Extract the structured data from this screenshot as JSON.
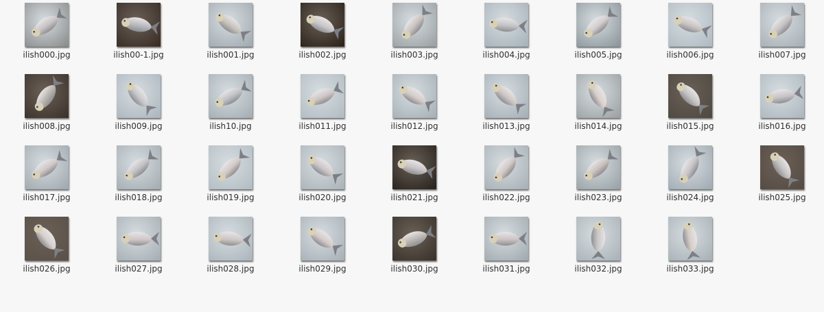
{
  "view": {
    "type": "icon-grid",
    "background": "#f7f7f7"
  },
  "files": [
    {
      "name": "ilish000.jpg",
      "bg": "#8e8f8f",
      "fish": "#c7c3c5",
      "angle": -35,
      "dark": false
    },
    {
      "name": "ilish00-1.jpg",
      "bg": "#3a2e26",
      "fish": "#b8b9be",
      "angle": 10,
      "dark": true
    },
    {
      "name": "ilish001.jpg",
      "bg": "#a3acb2",
      "fish": "#c6c2bb",
      "angle": 35,
      "dark": false
    },
    {
      "name": "ilish002.jpg",
      "bg": "#2d241c",
      "fish": "#c8c6c8",
      "angle": 25,
      "dark": true
    },
    {
      "name": "ilish003.jpg",
      "bg": "#9da3a5",
      "fish": "#c9c2c0",
      "angle": -50,
      "dark": false
    },
    {
      "name": "ilish004.jpg",
      "bg": "#a8b3bb",
      "fish": "#c3c4c6",
      "angle": 5,
      "dark": false
    },
    {
      "name": "ilish005.jpg",
      "bg": "#8f9a9e",
      "fish": "#d2cccd",
      "angle": -40,
      "dark": false
    },
    {
      "name": "ilish006.jpg",
      "bg": "#b1bcc3",
      "fish": "#c7c3c1",
      "angle": 20,
      "dark": false
    },
    {
      "name": "ilish007.jpg",
      "bg": "#a9b1b6",
      "fish": "#c6c3c4",
      "angle": -45,
      "dark": false
    },
    {
      "name": "ilish008.jpg",
      "bg": "#3d342c",
      "fish": "#b8b5b0",
      "angle": -55,
      "dark": true
    },
    {
      "name": "ilish009.jpg",
      "bg": "#aeb8bf",
      "fish": "#c5c6c9",
      "angle": 50,
      "dark": false
    },
    {
      "name": "ilish10.jpg",
      "bg": "#a6b0b6",
      "fish": "#bfc2c5",
      "angle": -30,
      "dark": false
    },
    {
      "name": "ilish011.jpg",
      "bg": "#b3bdc3",
      "fish": "#cdc8c6",
      "angle": -25,
      "dark": false
    },
    {
      "name": "ilish012.jpg",
      "bg": "#a8b2b7",
      "fish": "#d3cbc8",
      "angle": 30,
      "dark": false
    },
    {
      "name": "ilish013.jpg",
      "bg": "#a7b1b7",
      "fish": "#cbc4c2",
      "angle": 40,
      "dark": false
    },
    {
      "name": "ilish014.jpg",
      "bg": "#9ea4a5",
      "fish": "#d9d0cc",
      "angle": 60,
      "dark": false
    },
    {
      "name": "ilish015.jpg",
      "bg": "#4f4a42",
      "fish": "#c3c3c3",
      "angle": 45,
      "dark": true
    },
    {
      "name": "ilish016.jpg",
      "bg": "#aeb9bf",
      "fish": "#c5c4c7",
      "angle": -10,
      "dark": false
    },
    {
      "name": "ilish017.jpg",
      "bg": "#a2abb1",
      "fish": "#cfc8c7",
      "angle": -35,
      "dark": false
    },
    {
      "name": "ilish018.jpg",
      "bg": "#a6afb4",
      "fish": "#c1c2c4",
      "angle": -40,
      "dark": false
    },
    {
      "name": "ilish019.jpg",
      "bg": "#b4bec4",
      "fish": "#d2cac6",
      "angle": -45,
      "dark": false
    },
    {
      "name": "ilish020.jpg",
      "bg": "#acb5ba",
      "fish": "#cbc7c8",
      "angle": 35,
      "dark": false
    },
    {
      "name": "ilish021.jpg",
      "bg": "#2a2520",
      "fish": "#c7c3c4",
      "angle": 15,
      "dark": true
    },
    {
      "name": "ilish022.jpg",
      "bg": "#a9b2b7",
      "fish": "#d1c9c6",
      "angle": -50,
      "dark": false
    },
    {
      "name": "ilish023.jpg",
      "bg": "#9ba4a8",
      "fish": "#c9c1bd",
      "angle": -40,
      "dark": false
    },
    {
      "name": "ilish024.jpg",
      "bg": "#a3adb4",
      "fish": "#c6c5c7",
      "angle": -60,
      "dark": false
    },
    {
      "name": "ilish025.jpg",
      "bg": "#564c44",
      "fish": "#c4c1c1",
      "angle": 55,
      "dark": true
    },
    {
      "name": "ilish026.jpg",
      "bg": "#5a5148",
      "fish": "#d6cfcc",
      "angle": 50,
      "dark": true
    },
    {
      "name": "ilish027.jpg",
      "bg": "#a7b0b5",
      "fish": "#d0c8c8",
      "angle": 0,
      "dark": false
    },
    {
      "name": "ilish028.jpg",
      "bg": "#adb7bd",
      "fish": "#cdc8c6",
      "angle": 5,
      "dark": false
    },
    {
      "name": "ilish029.jpg",
      "bg": "#a9b2b8",
      "fish": "#d2cac8",
      "angle": 35,
      "dark": false
    },
    {
      "name": "ilish030.jpg",
      "bg": "#3b342c",
      "fish": "#b9b6b1",
      "angle": -20,
      "dark": true
    },
    {
      "name": "ilish031.jpg",
      "bg": "#a3acb1",
      "fish": "#cbc4c4",
      "angle": 0,
      "dark": false
    },
    {
      "name": "ilish032.jpg",
      "bg": "#abb4b9",
      "fish": "#c8c6c6",
      "angle": 90,
      "dark": false
    },
    {
      "name": "ilish033.jpg",
      "bg": "#aab3b8",
      "fish": "#d4ccc8",
      "angle": 80,
      "dark": false
    }
  ]
}
